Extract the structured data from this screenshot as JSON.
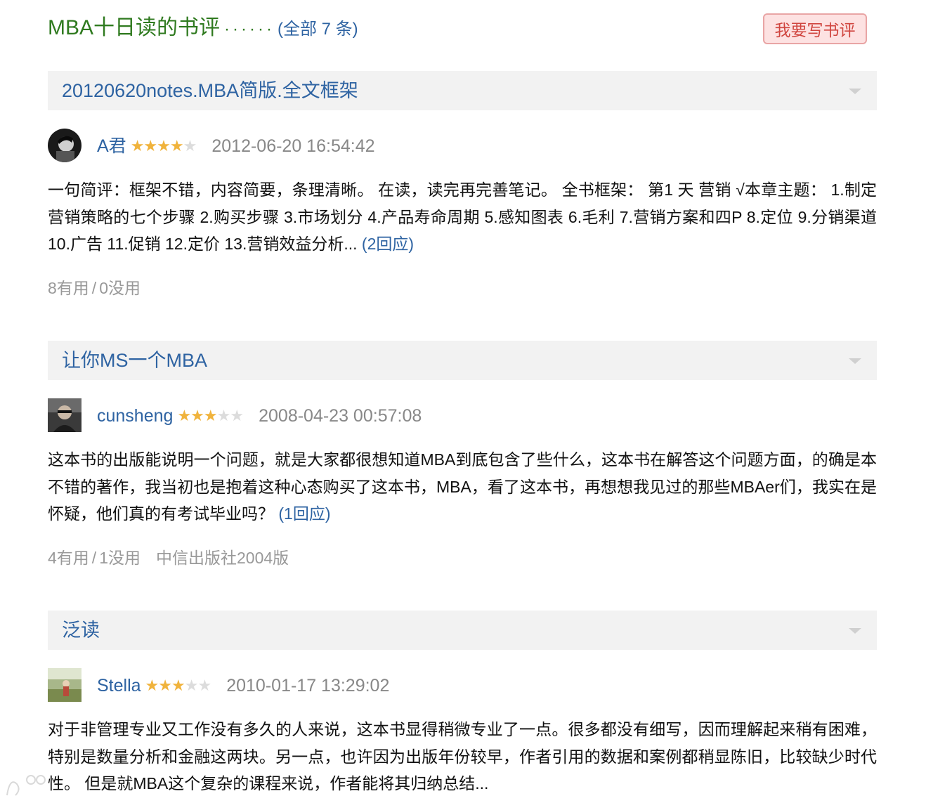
{
  "header": {
    "title": "MBA十日读的书评",
    "dots": "······",
    "all_link": "(全部 7 条)",
    "write_button": "我要写书评"
  },
  "reviews": [
    {
      "title": "20120620notes.MBA简版.全文框架",
      "author": "A君",
      "rating": 4,
      "date": "2012-06-20 16:54:42",
      "body": "一句简评：框架不错，内容简要，条理清晰。 在读，读完再完善笔记。 全书框架： 第1 天 营销 √本章主题： 1.制定营销策略的七个步骤 2.购买步骤 3.市场划分 4.产品寿命周期 5.感知图表 6.毛利 7.营销方案和四P 8.定位 9.分销渠道 10.广告 11.促销 12.定价 13.营销效益分析...",
      "reply": "(2回应)",
      "useful": "8有用",
      "useless": "0没用",
      "edition": ""
    },
    {
      "title": "让你MS一个MBA",
      "author": "cunsheng",
      "rating": 3,
      "date": "2008-04-23 00:57:08",
      "body": "这本书的出版能说明一个问题，就是大家都很想知道MBA到底包含了些什么，这本书在解答这个问题方面，的确是本不错的著作，我当初也是抱着这种心态购买了这本书，MBA，看了这本书，再想想我见过的那些MBAer们，我实在是怀疑，他们真的有考试毕业吗？",
      "reply": "(1回应)",
      "useful": "4有用",
      "useless": "1没用",
      "edition": "中信出版社2004版"
    },
    {
      "title": "泛读",
      "author": "Stella",
      "rating": 3,
      "date": "2010-01-17 13:29:02",
      "body": "对于非管理专业又工作没有多久的人来说，这本书显得稍微专业了一点。很多都没有细写，因而理解起来稍有困难，特别是数量分析和金融这两块。另一点，也许因为出版年份较早，作者引用的数据和案例都稍显陈旧，比较缺少时代性。 但是就MBA这个复杂的课程来说，作者能将其归纳总结...",
      "reply": "",
      "useful": "",
      "useless": "",
      "edition": ""
    }
  ],
  "colors": {
    "title_green": "#2f7a1f",
    "link_blue": "#2e63a2",
    "star": "#f0b33c",
    "button_bg": "#fde2e2",
    "button_text": "#d0453f"
  },
  "icons": {
    "collapse": "chevron-down-icon",
    "star": "star-icon"
  }
}
